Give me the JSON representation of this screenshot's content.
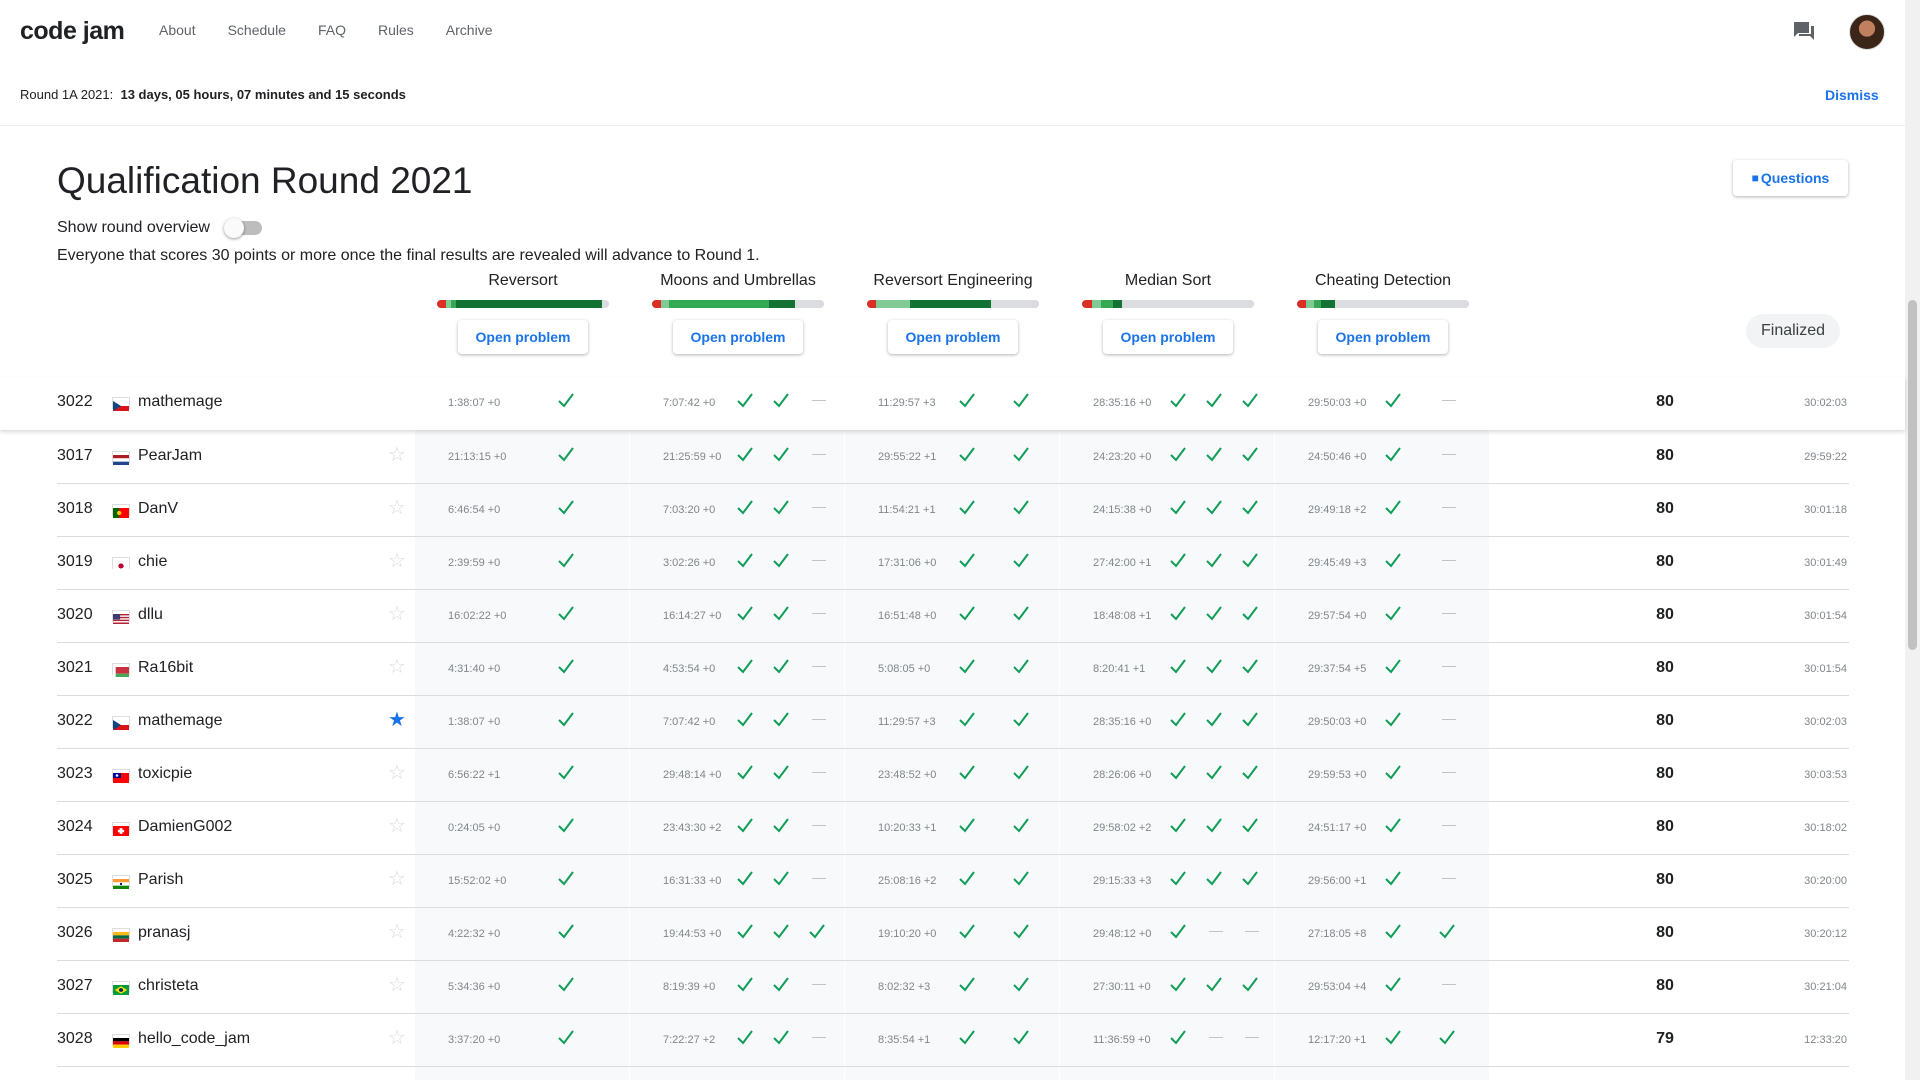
{
  "nav": {
    "logo": "code jam",
    "links": [
      "About",
      "Schedule",
      "FAQ",
      "Rules",
      "Archive"
    ]
  },
  "banner": {
    "label": "Round 1A 2021:",
    "countdown": "13 days, 05 hours, 07 minutes and 15 seconds",
    "dismiss": "Dismiss"
  },
  "page": {
    "title": "Qualification Round 2021",
    "questions_label": "Questions",
    "overview_label": "Show round overview",
    "notice": "Everyone that scores 30 points or more once the final results are revealed will advance to Round 1.",
    "finalized": "Finalized"
  },
  "problems": [
    {
      "name": "Reversort",
      "open": "Open problem"
    },
    {
      "name": "Moons and Umbrellas",
      "open": "Open problem"
    },
    {
      "name": "Reversort Engineering",
      "open": "Open problem"
    },
    {
      "name": "Median Sort",
      "open": "Open problem"
    },
    {
      "name": "Cheating Detection",
      "open": "Open problem"
    }
  ],
  "colors": {
    "accent": "#1a73e8",
    "check": "#0f9d58",
    "bar_red": "#d93025",
    "bar_light": "#81c995",
    "bar_mid": "#34a853",
    "bar_dark": "#137333"
  },
  "highlight": {
    "rank": "3022",
    "flag": "cz",
    "name": "mathemage",
    "p": [
      [
        "1:38:07 +0",
        "c"
      ],
      [
        "7:07:42 +0",
        "c",
        "c",
        "d"
      ],
      [
        "11:29:57 +3",
        "c",
        "c"
      ],
      [
        "28:35:16 +0",
        "c",
        "c",
        "c"
      ],
      [
        "29:50:03 +0",
        "c",
        "d"
      ]
    ],
    "score": "80",
    "penalty": "30:02:03"
  },
  "rows": [
    {
      "rank": "3017",
      "flag": "nl",
      "name": "PearJam",
      "star": false,
      "p": [
        [
          "21:13:15 +0",
          "c"
        ],
        [
          "21:25:59 +0",
          "c",
          "c",
          "d"
        ],
        [
          "29:55:22 +1",
          "c",
          "c"
        ],
        [
          "24:23:20 +0",
          "c",
          "c",
          "c"
        ],
        [
          "24:50:46 +0",
          "c",
          "d"
        ]
      ],
      "score": "80",
      "penalty": "29:59:22"
    },
    {
      "rank": "3018",
      "flag": "pt",
      "name": "DanV",
      "star": false,
      "p": [
        [
          "6:46:54 +0",
          "c"
        ],
        [
          "7:03:20 +0",
          "c",
          "c",
          "d"
        ],
        [
          "11:54:21 +1",
          "c",
          "c"
        ],
        [
          "24:15:38 +0",
          "c",
          "c",
          "c"
        ],
        [
          "29:49:18 +2",
          "c",
          "d"
        ]
      ],
      "score": "80",
      "penalty": "30:01:18"
    },
    {
      "rank": "3019",
      "flag": "jp",
      "name": "chie",
      "star": false,
      "p": [
        [
          "2:39:59 +0",
          "c"
        ],
        [
          "3:02:26 +0",
          "c",
          "c",
          "d"
        ],
        [
          "17:31:06 +0",
          "c",
          "c"
        ],
        [
          "27:42:00 +1",
          "c",
          "c",
          "c"
        ],
        [
          "29:45:49 +3",
          "c",
          "d"
        ]
      ],
      "score": "80",
      "penalty": "30:01:49"
    },
    {
      "rank": "3020",
      "flag": "us",
      "name": "dllu",
      "star": false,
      "p": [
        [
          "16:02:22 +0",
          "c"
        ],
        [
          "16:14:27 +0",
          "c",
          "c",
          "d"
        ],
        [
          "16:51:48 +0",
          "c",
          "c"
        ],
        [
          "18:48:08 +1",
          "c",
          "c",
          "c"
        ],
        [
          "29:57:54 +0",
          "c",
          "d"
        ]
      ],
      "score": "80",
      "penalty": "30:01:54"
    },
    {
      "rank": "3021",
      "flag": "by",
      "name": "Ra16bit",
      "star": false,
      "p": [
        [
          "4:31:40 +0",
          "c"
        ],
        [
          "4:53:54 +0",
          "c",
          "c",
          "d"
        ],
        [
          "5:08:05 +0",
          "c",
          "c"
        ],
        [
          "8:20:41 +1",
          "c",
          "c",
          "c"
        ],
        [
          "29:37:54 +5",
          "c",
          "d"
        ]
      ],
      "score": "80",
      "penalty": "30:01:54"
    },
    {
      "rank": "3022",
      "flag": "cz",
      "name": "mathemage",
      "star": true,
      "p": [
        [
          "1:38:07 +0",
          "c"
        ],
        [
          "7:07:42 +0",
          "c",
          "c",
          "d"
        ],
        [
          "11:29:57 +3",
          "c",
          "c"
        ],
        [
          "28:35:16 +0",
          "c",
          "c",
          "c"
        ],
        [
          "29:50:03 +0",
          "c",
          "d"
        ]
      ],
      "score": "80",
      "penalty": "30:02:03"
    },
    {
      "rank": "3023",
      "flag": "tw",
      "name": "toxicpie",
      "star": false,
      "p": [
        [
          "6:56:22 +1",
          "c"
        ],
        [
          "29:48:14 +0",
          "c",
          "c",
          "d"
        ],
        [
          "23:48:52 +0",
          "c",
          "c"
        ],
        [
          "28:26:06 +0",
          "c",
          "c",
          "c"
        ],
        [
          "29:59:53 +0",
          "c",
          "d"
        ]
      ],
      "score": "80",
      "penalty": "30:03:53"
    },
    {
      "rank": "3024",
      "flag": "ch",
      "name": "DamienG002",
      "star": false,
      "p": [
        [
          "0:24:05 +0",
          "c"
        ],
        [
          "23:43:30 +2",
          "c",
          "c",
          "d"
        ],
        [
          "10:20:33 +1",
          "c",
          "c"
        ],
        [
          "29:58:02 +2",
          "c",
          "c",
          "c"
        ],
        [
          "24:51:17 +0",
          "c",
          "d"
        ]
      ],
      "score": "80",
      "penalty": "30:18:02"
    },
    {
      "rank": "3025",
      "flag": "in",
      "name": "Parish",
      "star": false,
      "p": [
        [
          "15:52:02 +0",
          "c"
        ],
        [
          "16:31:33 +0",
          "c",
          "c",
          "d"
        ],
        [
          "25:08:16 +2",
          "c",
          "c"
        ],
        [
          "29:15:33 +3",
          "c",
          "c",
          "c"
        ],
        [
          "29:56:00 +1",
          "c",
          "d"
        ]
      ],
      "score": "80",
      "penalty": "30:20:00"
    },
    {
      "rank": "3026",
      "flag": "lt",
      "name": "pranasj",
      "star": false,
      "p": [
        [
          "4:22:32 +0",
          "c"
        ],
        [
          "19:44:53 +0",
          "c",
          "c",
          "c"
        ],
        [
          "19:10:20 +0",
          "c",
          "c"
        ],
        [
          "29:48:12 +0",
          "c",
          "d",
          "d"
        ],
        [
          "27:18:05 +8",
          "c",
          "c"
        ]
      ],
      "score": "80",
      "penalty": "30:20:12"
    },
    {
      "rank": "3027",
      "flag": "br",
      "name": "christeta",
      "star": false,
      "p": [
        [
          "5:34:36 +0",
          "c"
        ],
        [
          "8:19:39 +0",
          "c",
          "c",
          "d"
        ],
        [
          "8:02:32 +3",
          "c",
          "c"
        ],
        [
          "27:30:11 +0",
          "c",
          "c",
          "c"
        ],
        [
          "29:53:04 +4",
          "c",
          "d"
        ]
      ],
      "score": "80",
      "penalty": "30:21:04"
    },
    {
      "rank": "3028",
      "flag": "de",
      "name": "hello_code_jam",
      "star": false,
      "p": [
        [
          "3:37:20 +0",
          "c"
        ],
        [
          "7:22:27 +2",
          "c",
          "c",
          "d"
        ],
        [
          "8:35:54 +1",
          "c",
          "c"
        ],
        [
          "11:36:59 +0",
          "c",
          "d",
          "d"
        ],
        [
          "12:17:20 +1",
          "c",
          "c"
        ]
      ],
      "score": "79",
      "penalty": "12:33:20"
    }
  ]
}
